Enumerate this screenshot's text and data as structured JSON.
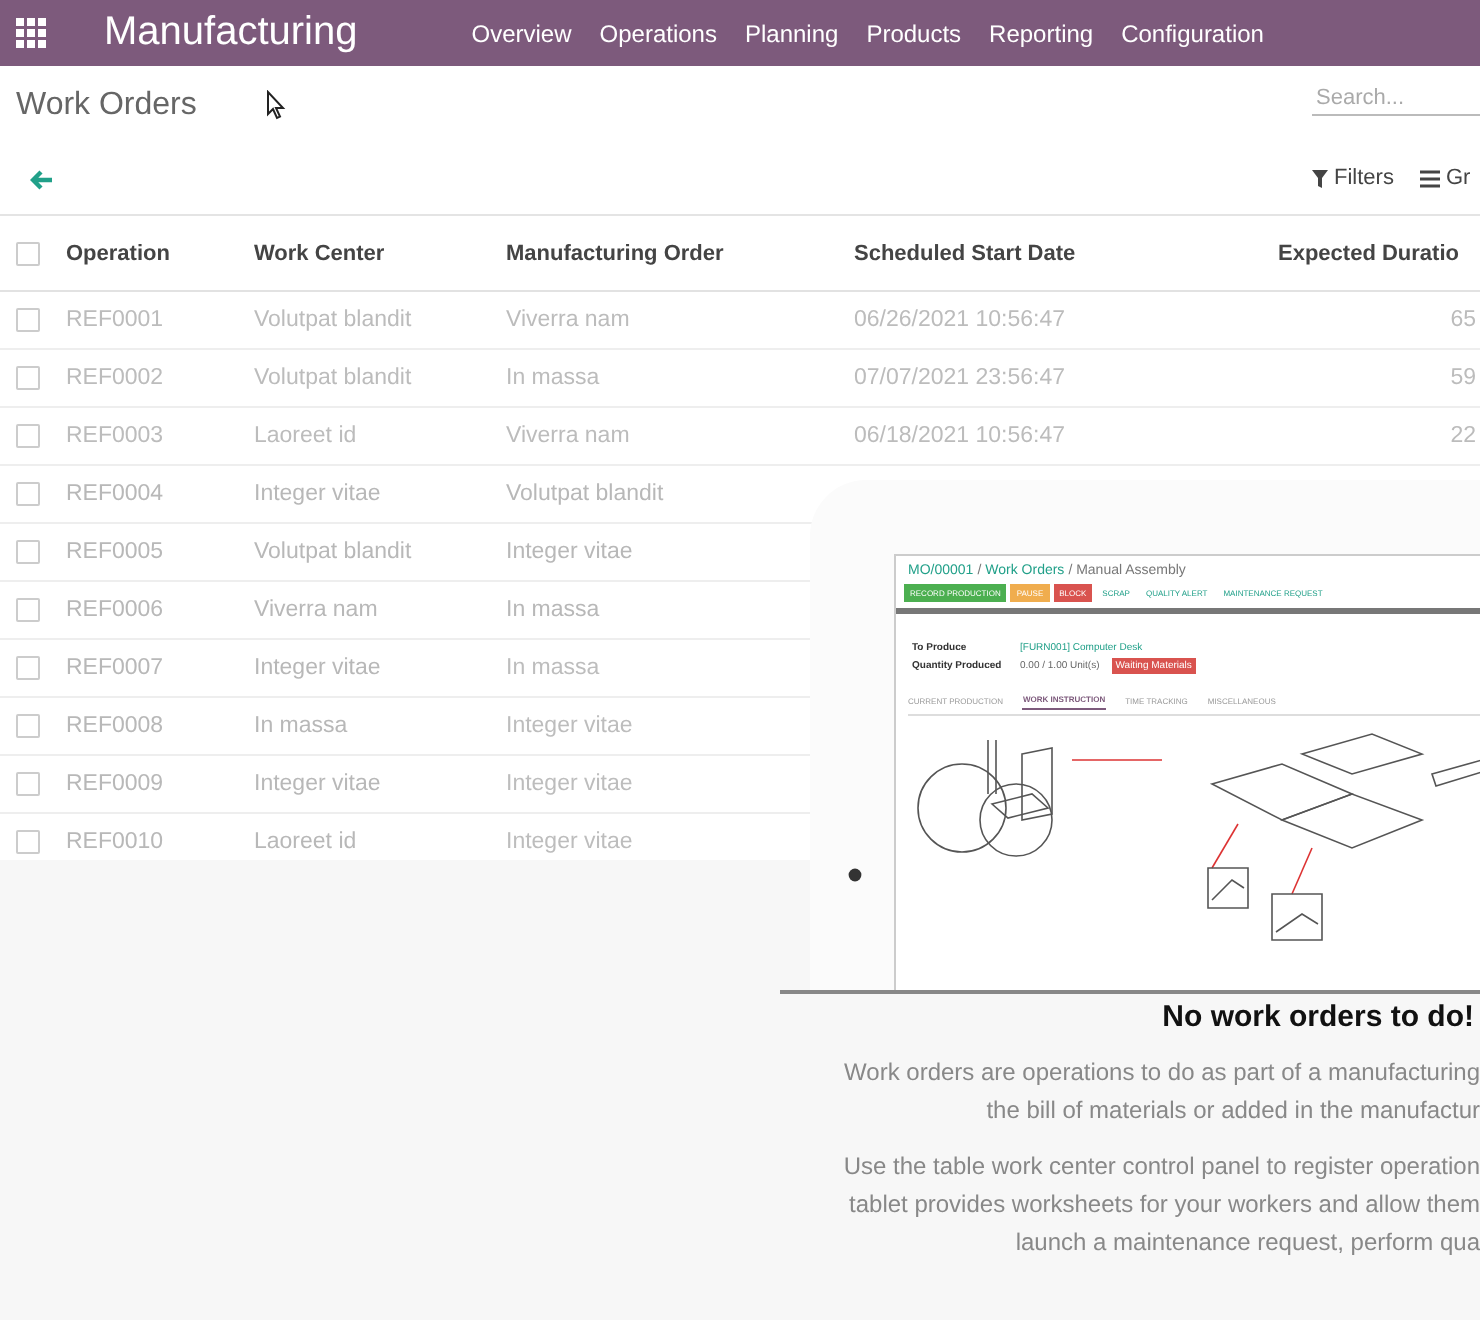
{
  "app_bar": {
    "title": "Manufacturing",
    "menu": [
      "Overview",
      "Operations",
      "Planning",
      "Products",
      "Reporting",
      "Configuration"
    ]
  },
  "control_panel": {
    "title": "Work Orders",
    "search": {
      "placeholder": "Search..."
    },
    "filters": "Filters",
    "group_by": "Gr"
  },
  "table": {
    "select_all": {
      "checked": false
    },
    "columns": [
      "Operation",
      "Work Center",
      "Manufacturing Order",
      "Scheduled Start Date",
      "Expected Duratio"
    ],
    "rows": [
      {
        "checked": false,
        "cells": [
          "REF0001",
          "Volutpat blandit",
          "Viverra nam",
          "06/26/2021 10:56:47",
          "65"
        ]
      },
      {
        "checked": false,
        "cells": [
          "REF0002",
          "Volutpat blandit",
          "In massa",
          "07/07/2021 23:56:47",
          "59"
        ]
      },
      {
        "checked": false,
        "cells": [
          "REF0003",
          "Laoreet id",
          "Viverra nam",
          "06/18/2021 10:56:47",
          "22"
        ]
      },
      {
        "checked": false,
        "cells": [
          "REF0004",
          "Integer vitae",
          "Volutpat blandit"
        ]
      },
      {
        "checked": false,
        "cells": [
          "REF0005",
          "Volutpat blandit",
          "Integer vitae"
        ]
      },
      {
        "checked": false,
        "cells": [
          "REF0006",
          "Viverra nam",
          "In massa"
        ]
      },
      {
        "checked": false,
        "cells": [
          "REF0007",
          "Integer vitae",
          "In massa"
        ]
      },
      {
        "checked": false,
        "cells": [
          "REF0008",
          "In massa",
          "Integer vitae"
        ]
      },
      {
        "checked": false,
        "cells": [
          "REF0009",
          "Integer vitae",
          "Integer vitae"
        ]
      },
      {
        "checked": false,
        "cells": [
          "REF0010",
          "Laoreet id",
          "Integer vitae"
        ]
      }
    ]
  },
  "help": {
    "preview": {
      "breadcrumb": [
        {
          "label": "MO/00001",
          "link": true
        },
        {
          "label": "/",
          "link": false
        },
        {
          "label": "Work Orders",
          "link": true
        },
        {
          "label": "/ Manual Assembly",
          "link": false
        }
      ],
      "actions": [
        {
          "label": "RECORD PRODUCTION",
          "kind": "success"
        },
        {
          "label": "PAUSE",
          "kind": "warning"
        },
        {
          "label": "BLOCK",
          "kind": "danger"
        },
        {
          "label": "SCRAP",
          "kind": "link"
        },
        {
          "label": "QUALITY ALERT",
          "kind": "link"
        },
        {
          "label": "MAINTENANCE REQUEST",
          "kind": "link"
        }
      ],
      "fields": [
        {
          "label": "To Produce",
          "value": "[FURN001] Computer Desk"
        },
        {
          "label": "Quantity Produced",
          "value": "0.00 / 1.00 Unit(s)",
          "badge": "Waiting Materials"
        }
      ],
      "tabs": [
        {
          "label": "CURRENT PRODUCTION",
          "selected": false
        },
        {
          "label": "WORK INSTRUCTION",
          "selected": true
        },
        {
          "label": "TIME TRACKING",
          "selected": false
        },
        {
          "label": "MISCELLANEOUS",
          "selected": false
        }
      ]
    },
    "title": "No work orders to do!",
    "paragraphs": [
      [
        "Work orders are operations to do as part of a manufacturing",
        "the bill of materials or added in the manufactur"
      ],
      [
        "Use the table work center control panel to register operation",
        "tablet provides worksheets for your workers and allow them",
        "launch a maintenance request, perform qua"
      ]
    ]
  }
}
